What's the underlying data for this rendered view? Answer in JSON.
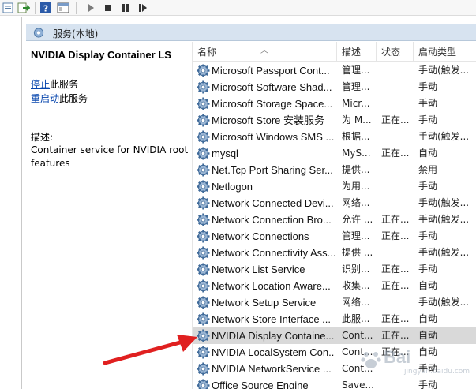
{
  "header": {
    "title": "服务(本地)"
  },
  "details": {
    "service_name": "NVIDIA Display Container LS",
    "stop_link": "停止",
    "stop_suffix": "此服务",
    "restart_link": "重启动",
    "restart_suffix": "此服务",
    "desc_label": "描述:",
    "description": "Container service for NVIDIA root features"
  },
  "columns": {
    "name": "名称",
    "desc": "描述",
    "status": "状态",
    "startup": "启动类型"
  },
  "services": [
    {
      "name": "Microsoft Passport Cont...",
      "desc": "管理...",
      "status": "",
      "startup": "手动(触发..."
    },
    {
      "name": "Microsoft Software Shad...",
      "desc": "管理...",
      "status": "",
      "startup": "手动"
    },
    {
      "name": "Microsoft Storage Space...",
      "desc": "Micr...",
      "status": "",
      "startup": "手动"
    },
    {
      "name": "Microsoft Store 安装服务",
      "desc": "为 M...",
      "status": "正在...",
      "startup": "手动"
    },
    {
      "name": "Microsoft Windows SMS ...",
      "desc": "根据...",
      "status": "",
      "startup": "手动(触发..."
    },
    {
      "name": "mysql",
      "desc": "MyS...",
      "status": "正在...",
      "startup": "自动"
    },
    {
      "name": "Net.Tcp Port Sharing Ser...",
      "desc": "提供...",
      "status": "",
      "startup": "禁用"
    },
    {
      "name": "Netlogon",
      "desc": "为用...",
      "status": "",
      "startup": "手动"
    },
    {
      "name": "Network Connected Devi...",
      "desc": "网络...",
      "status": "",
      "startup": "手动(触发..."
    },
    {
      "name": "Network Connection Bro...",
      "desc": "允许 ...",
      "status": "正在...",
      "startup": "手动(触发..."
    },
    {
      "name": "Network Connections",
      "desc": "管理...",
      "status": "正在...",
      "startup": "手动"
    },
    {
      "name": "Network Connectivity Ass...",
      "desc": "提供 ...",
      "status": "",
      "startup": "手动(触发..."
    },
    {
      "name": "Network List Service",
      "desc": "识别...",
      "status": "正在...",
      "startup": "手动"
    },
    {
      "name": "Network Location Aware...",
      "desc": "收集...",
      "status": "正在...",
      "startup": "自动"
    },
    {
      "name": "Network Setup Service",
      "desc": "网络...",
      "status": "",
      "startup": "手动(触发..."
    },
    {
      "name": "Network Store Interface ...",
      "desc": "此服...",
      "status": "正在...",
      "startup": "自动"
    },
    {
      "name": "NVIDIA Display Containe...",
      "desc": "Cont...",
      "status": "正在...",
      "startup": "自动",
      "selected": true
    },
    {
      "name": "NVIDIA LocalSystem Con...",
      "desc": "Cont...",
      "status": "正在...",
      "startup": "自动"
    },
    {
      "name": "NVIDIA NetworkService ...",
      "desc": "Cont...",
      "status": "",
      "startup": "手动"
    },
    {
      "name": "Office  Source Engine",
      "desc": "Save...",
      "status": "",
      "startup": "手动"
    }
  ],
  "watermark": {
    "brand": "Bai",
    "sub": "jingyan.baidu.com"
  },
  "colors": {
    "accent_link": "#0645ad",
    "header_bg": "#d7e3f0",
    "selected_row": "#d9d9d9",
    "arrow": "#e02020"
  }
}
